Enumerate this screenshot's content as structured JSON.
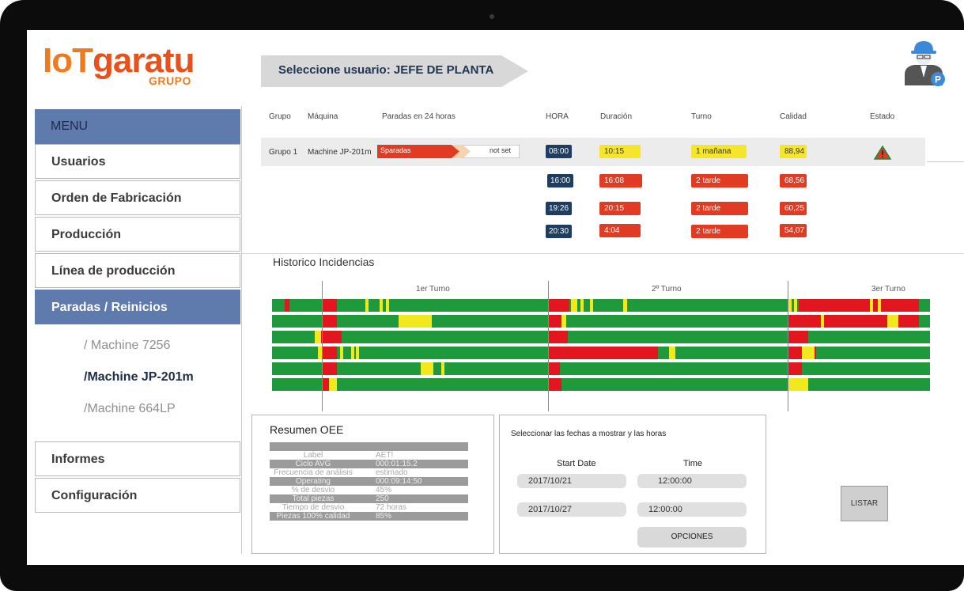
{
  "header": {
    "logo_iot": "IoT",
    "logo_name": "garatu",
    "logo_sub": "GRUPO",
    "user_prefix": "Seleccione usuario: ",
    "user_role": "JEFE DE PLANTA",
    "avatar_badge": "P"
  },
  "sidebar": {
    "menu_title": "MENU",
    "items": [
      {
        "label": "Usuarios"
      },
      {
        "label": "Orden de Fabricación"
      },
      {
        "label": "Producción"
      },
      {
        "label": "Línea de producción"
      },
      {
        "label": "Paradas / Reinicios"
      }
    ],
    "sub_items": [
      {
        "label": "/ Machine 7256"
      },
      {
        "label": "/Machine JP-201m"
      },
      {
        "label": "/Machine 664LP"
      }
    ],
    "bottom_items": [
      {
        "label": "Informes"
      },
      {
        "label": "Configuración"
      }
    ]
  },
  "table": {
    "headers": {
      "grupo": "Grupo",
      "maquina": "Máquina",
      "paradas": "Paradas en 24 horas",
      "hora": "HORA",
      "duracion": "Duración",
      "turno": "Turno",
      "calidad": "Calidad",
      "estado": "Estado"
    },
    "row": {
      "grupo": "Grupo 1",
      "maquina": "Machine JP-201m",
      "paradas_label": "Sparadas",
      "paradas_value": "not set",
      "status_icon": "warning-triangle"
    },
    "entries": [
      {
        "hora": "08:00",
        "duracion": "10:15",
        "turno": "1 mañana",
        "calidad": "88,94",
        "color": "yellow"
      },
      {
        "hora": "16:00",
        "duracion": "16:08",
        "turno": "2 tarde",
        "calidad": "68,56",
        "color": "red"
      },
      {
        "hora": "19:26",
        "duracion": "20:15",
        "turno": "2 tarde",
        "calidad": "60,25",
        "color": "red"
      },
      {
        "hora": "20:30",
        "duracion": "4:04",
        "turno": "2 tarde",
        "calidad": "54,07",
        "color": "red"
      }
    ]
  },
  "historico": {
    "title": "Historico Incidencias",
    "shifts": [
      "1er Turno",
      "2º Turno",
      "3er Turno"
    ],
    "colors": {
      "ok": "#1e9a3c",
      "stop": "#e2161e",
      "warn": "#f2e81e"
    }
  },
  "oee": {
    "title": "Resumen OEE",
    "rows": [
      {
        "k": "Label",
        "v": "AET!",
        "dark": false
      },
      {
        "k": "Ciclo AVG",
        "v": "000:01:15.2",
        "dark": true
      },
      {
        "k": "Frecuencia de análisis",
        "v": "estimado",
        "dark": false
      },
      {
        "k": "Operating",
        "v": "000:09:14:50",
        "dark": true
      },
      {
        "k": "% de desvio",
        "v": "45%",
        "dark": false
      },
      {
        "k": "Total piezas",
        "v": "250",
        "dark": true
      },
      {
        "k": "Tiempo de desvio",
        "v": "72 horas",
        "dark": false
      },
      {
        "k": "Piezas 100% calidad",
        "v": "85%",
        "dark": true
      }
    ]
  },
  "dates": {
    "title": "Seleccionar las fechas a mostrar y las horas",
    "start_label": "Start Date",
    "time_label": "Time",
    "start_date": "2017/10/21",
    "start_time": "12:00:00",
    "end_date": "2017/10/27",
    "end_time": "12:00:00",
    "options_label": "OPCIONES"
  },
  "listar_label": "LISTAR"
}
